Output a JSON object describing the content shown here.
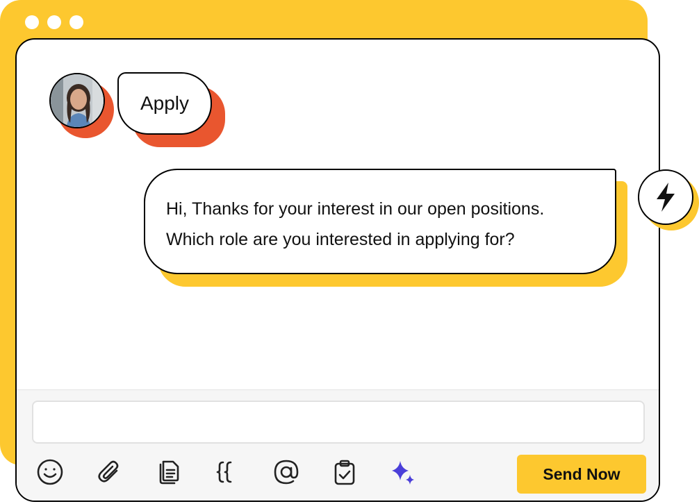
{
  "incoming": {
    "text": "Apply"
  },
  "outgoing": {
    "line1": "Hi, Thanks for your interest in our open positions.",
    "line2": "Which role are you interested in applying for?"
  },
  "composer": {
    "placeholder": "",
    "send_label": "Send Now",
    "toolbar_icons": [
      "emoji-icon",
      "paperclip-icon",
      "template-icon",
      "variable-braces-icon",
      "mention-icon",
      "clipboard-check-icon",
      "ai-sparkle-icon"
    ]
  },
  "colors": {
    "accent_yellow": "#FDC82F",
    "accent_orange": "#E9562F",
    "ai_purple": "#4B3FD9"
  }
}
